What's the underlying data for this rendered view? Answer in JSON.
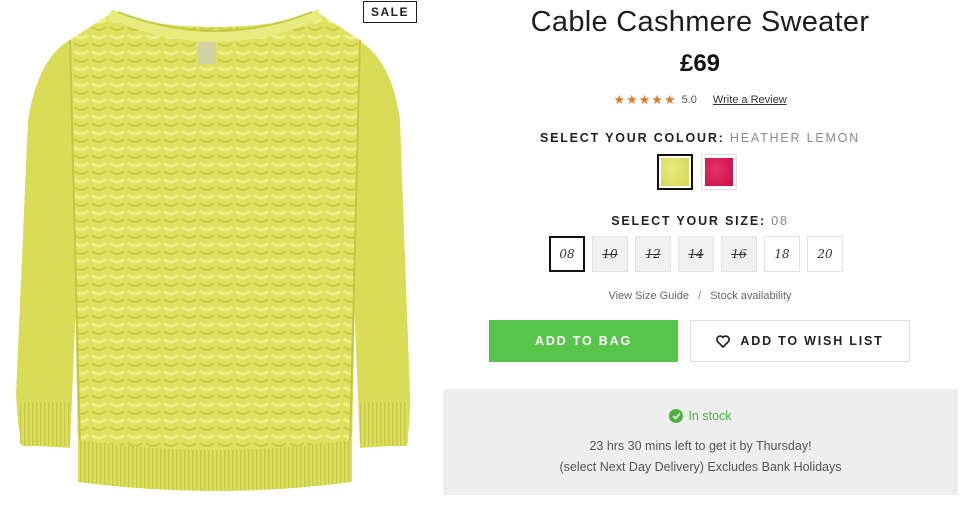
{
  "product": {
    "badge": "SALE",
    "title": "Cable Cashmere Sweater",
    "price": "£69",
    "image_icon": "sweater-image"
  },
  "rating": {
    "stars": 5,
    "score": "5.0",
    "review_link": "Write a Review"
  },
  "colour": {
    "label": "SELECT YOUR COLOUR:",
    "selected": "HEATHER LEMON",
    "swatches": [
      {
        "name": "heather-lemon",
        "color": "#dfe26a",
        "selected": true
      },
      {
        "name": "pink",
        "color": "#d8174f",
        "selected": false
      }
    ]
  },
  "size": {
    "label": "SELECT YOUR SIZE:",
    "selected": "08",
    "options": [
      {
        "label": "08",
        "available": true,
        "selected": true
      },
      {
        "label": "10",
        "available": false,
        "selected": false
      },
      {
        "label": "12",
        "available": false,
        "selected": false
      },
      {
        "label": "14",
        "available": false,
        "selected": false
      },
      {
        "label": "16",
        "available": false,
        "selected": false
      },
      {
        "label": "18",
        "available": true,
        "selected": false
      },
      {
        "label": "20",
        "available": true,
        "selected": false
      }
    ]
  },
  "links": {
    "size_guide": "View Size Guide",
    "separator": "/",
    "stock": "Stock availability"
  },
  "actions": {
    "add_to_bag": "ADD TO BAG",
    "add_to_wish": "ADD TO WISH LIST"
  },
  "stock": {
    "status": "In stock",
    "delivery_line1": "23 hrs 30 mins left to get it by Thursday!",
    "delivery_line2": "(select Next Day Delivery) Excludes Bank Holidays"
  },
  "colors": {
    "accent_green": "#57c44a",
    "star_orange": "#e07a2a",
    "sweater_yellow": "#dfe26a"
  }
}
